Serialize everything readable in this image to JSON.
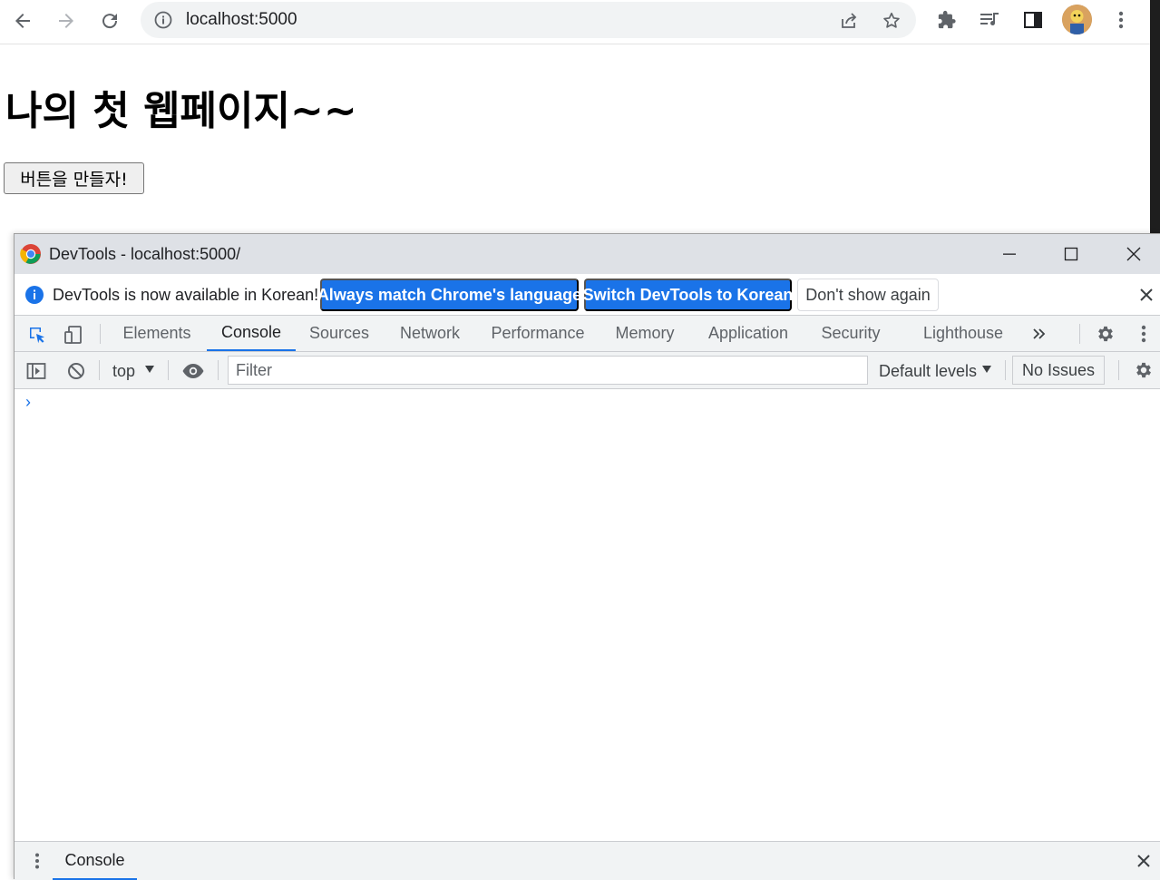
{
  "browser": {
    "url": "localhost:5000"
  },
  "page": {
    "heading": "나의 첫 웹페이지~~",
    "button_label": "버튼을 만들자!"
  },
  "devtools": {
    "window_title": "DevTools - localhost:5000/",
    "infobar": {
      "message": "DevTools is now available in Korean!",
      "btn_always_match": "Always match Chrome's language",
      "btn_switch": "Switch DevTools to Korean",
      "btn_dont_show": "Don't show again"
    },
    "tabs": [
      {
        "label": "Elements"
      },
      {
        "label": "Console"
      },
      {
        "label": "Sources"
      },
      {
        "label": "Network"
      },
      {
        "label": "Performance"
      },
      {
        "label": "Memory"
      },
      {
        "label": "Application"
      },
      {
        "label": "Security"
      },
      {
        "label": "Lighthouse"
      }
    ],
    "active_tab": "Console",
    "console_toolbar": {
      "context": "top",
      "filter_placeholder": "Filter",
      "levels": "Default levels",
      "issues": "No Issues"
    },
    "prompt": "›",
    "drawer": {
      "tab": "Console"
    }
  },
  "colors": {
    "accent": "#1a73e8"
  }
}
